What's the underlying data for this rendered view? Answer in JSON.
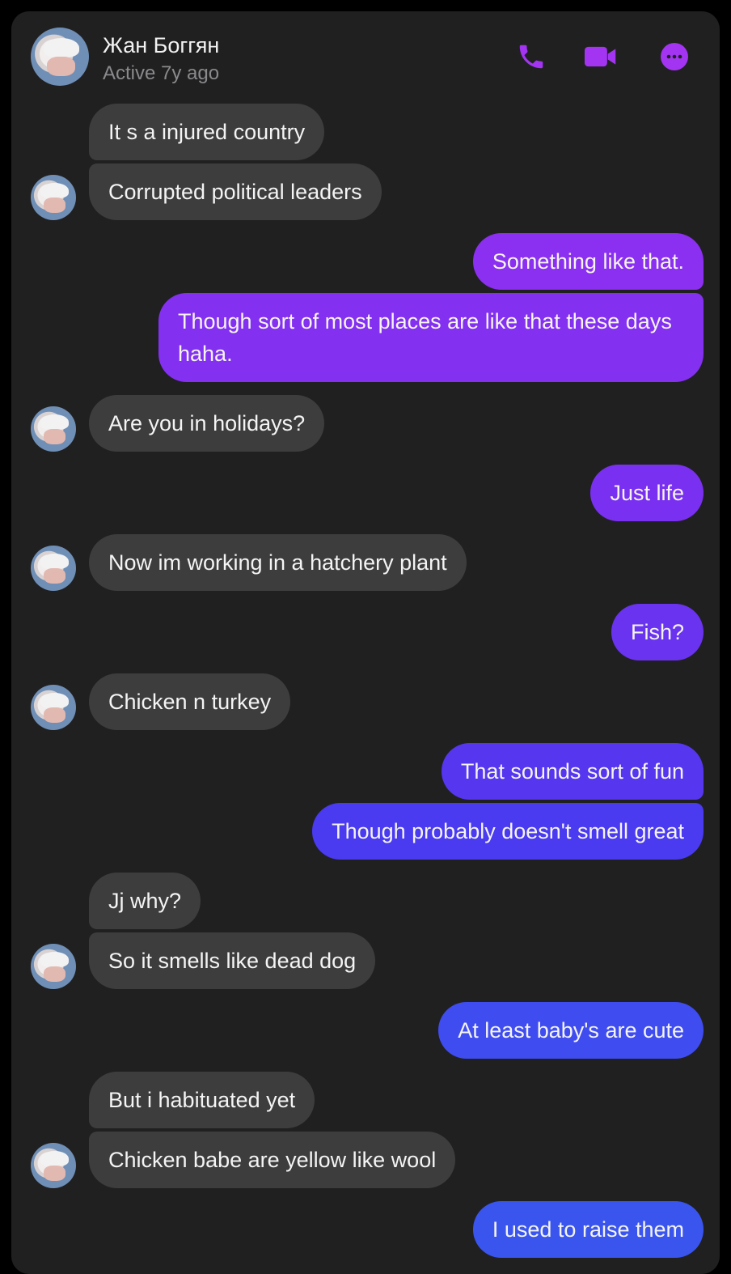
{
  "contact": {
    "name": "Жан Боггян",
    "status": "Active 7y ago"
  },
  "header_icons": [
    "phone-icon",
    "video-camera-icon",
    "more-options-icon"
  ],
  "colors": {
    "background": "#202021",
    "incoming_bubble": "#3d3d3e",
    "accent": "#9b2ff0",
    "outgoing_gradient": [
      "#8b2ff0",
      "#7a30f0",
      "#4a3af0",
      "#3a55ee"
    ]
  },
  "messages": [
    {
      "side": "incoming",
      "text": "It s a injured country"
    },
    {
      "side": "incoming",
      "text": "Corrupted political leaders"
    },
    {
      "side": "outgoing",
      "text": "Something like that."
    },
    {
      "side": "outgoing",
      "text": "Though sort of most places are like that these days haha."
    },
    {
      "side": "incoming",
      "text": "Are you in holidays?"
    },
    {
      "side": "outgoing",
      "text": "Just life"
    },
    {
      "side": "incoming",
      "text": "Now im working in a hatchery plant"
    },
    {
      "side": "outgoing",
      "text": "Fish?"
    },
    {
      "side": "incoming",
      "text": "Chicken n turkey"
    },
    {
      "side": "outgoing",
      "text": "That sounds sort of fun"
    },
    {
      "side": "outgoing",
      "text": "Though probably doesn't smell great"
    },
    {
      "side": "incoming",
      "text": "Jj why?"
    },
    {
      "side": "incoming",
      "text": "So it smells like dead dog"
    },
    {
      "side": "outgoing",
      "text": "At least baby's are cute"
    },
    {
      "side": "incoming",
      "text": "But i habituated yet"
    },
    {
      "side": "incoming",
      "text": "Chicken babe are yellow like wool"
    },
    {
      "side": "outgoing",
      "text": "I used to raise them"
    }
  ]
}
